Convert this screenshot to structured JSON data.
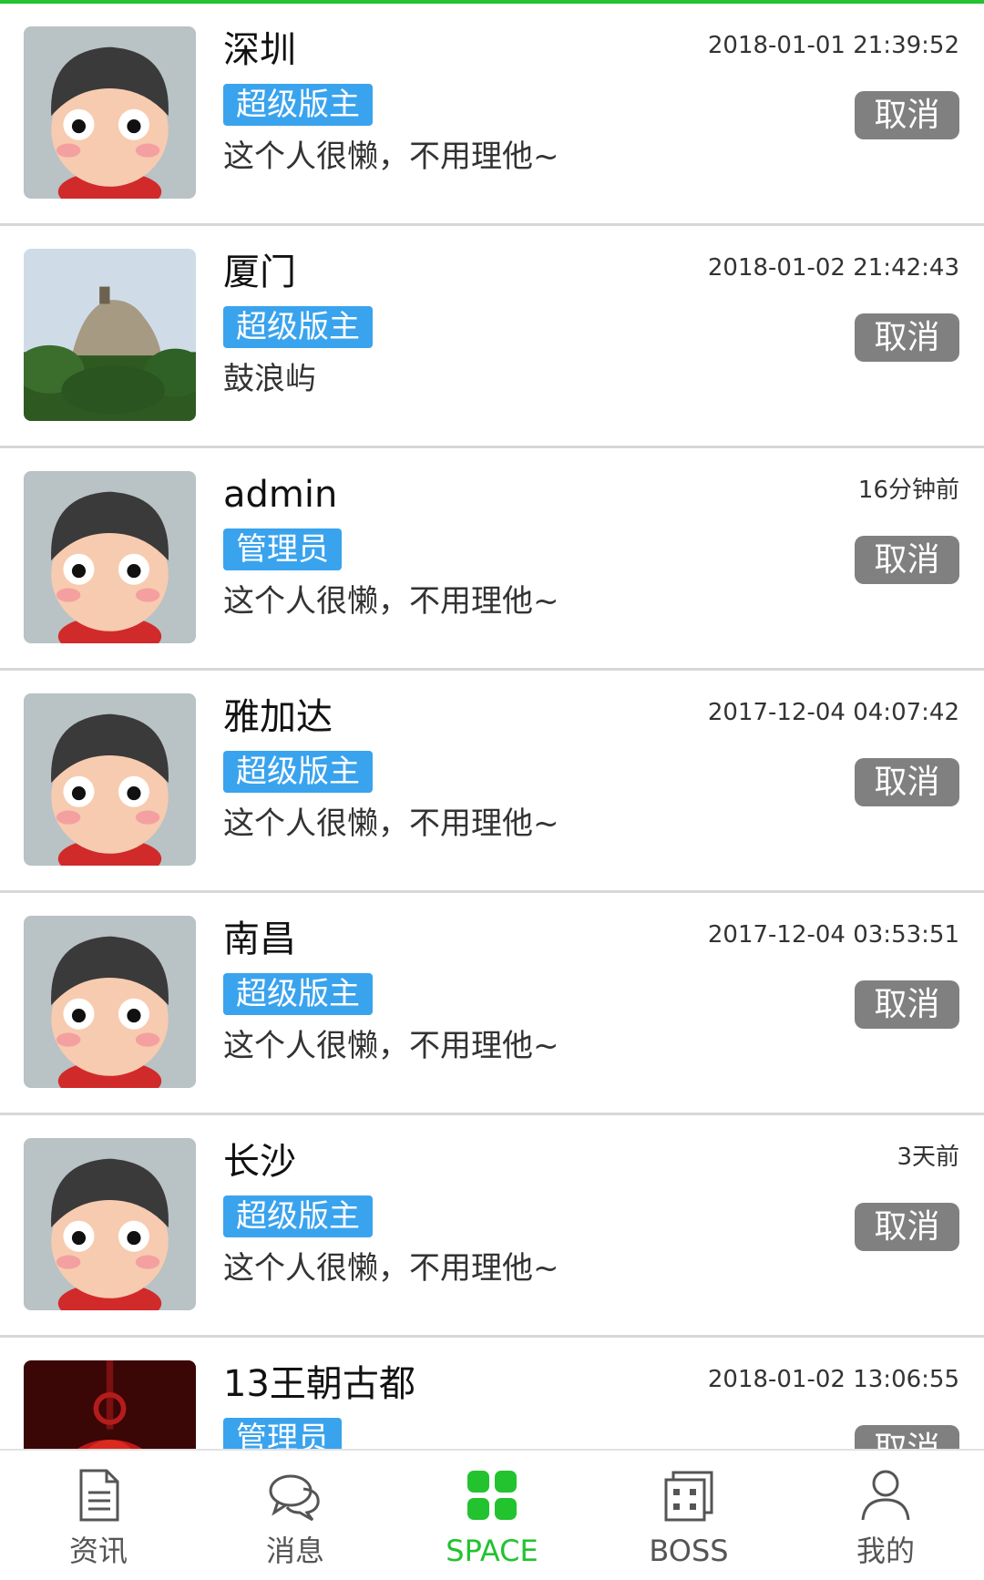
{
  "accent_color": "#22c32e",
  "badge_color": "#3aa3ee",
  "list": {
    "items": [
      {
        "name": "深圳",
        "role": "超级版主",
        "signature": "这个人很懒，不用理他~",
        "time": "2018-01-01 21:39:52",
        "action": "取消",
        "avatar": "cartoon-avatar"
      },
      {
        "name": "厦门",
        "role": "超级版主",
        "signature": "鼓浪屿",
        "time": "2018-01-02 21:42:43",
        "action": "取消",
        "avatar": "photo-rock-hill"
      },
      {
        "name": "admin",
        "role": "管理员",
        "signature": "这个人很懒，不用理他~",
        "time": "16分钟前",
        "action": "取消",
        "avatar": "cartoon-avatar"
      },
      {
        "name": "雅加达",
        "role": "超级版主",
        "signature": "这个人很懒，不用理他~",
        "time": "2017-12-04 04:07:42",
        "action": "取消",
        "avatar": "cartoon-avatar"
      },
      {
        "name": "南昌",
        "role": "超级版主",
        "signature": "这个人很懒，不用理他~",
        "time": "2017-12-04 03:53:51",
        "action": "取消",
        "avatar": "cartoon-avatar"
      },
      {
        "name": "长沙",
        "role": "超级版主",
        "signature": "这个人很懒，不用理他~",
        "time": "3天前",
        "action": "取消",
        "avatar": "cartoon-avatar"
      },
      {
        "name": "13王朝古都",
        "role": "管理员",
        "signature": "",
        "time": "2018-01-02 13:06:55",
        "action": "取消",
        "avatar": "photo-red-lantern"
      }
    ]
  },
  "tabbar": {
    "tabs": [
      {
        "label": "资讯",
        "icon": "document-icon",
        "active": false
      },
      {
        "label": "消息",
        "icon": "chat-bubbles-icon",
        "active": false
      },
      {
        "label": "SPACE",
        "icon": "grid-icon",
        "active": true
      },
      {
        "label": "BOSS",
        "icon": "building-icon",
        "active": false
      },
      {
        "label": "我的",
        "icon": "person-icon",
        "active": false
      }
    ]
  }
}
